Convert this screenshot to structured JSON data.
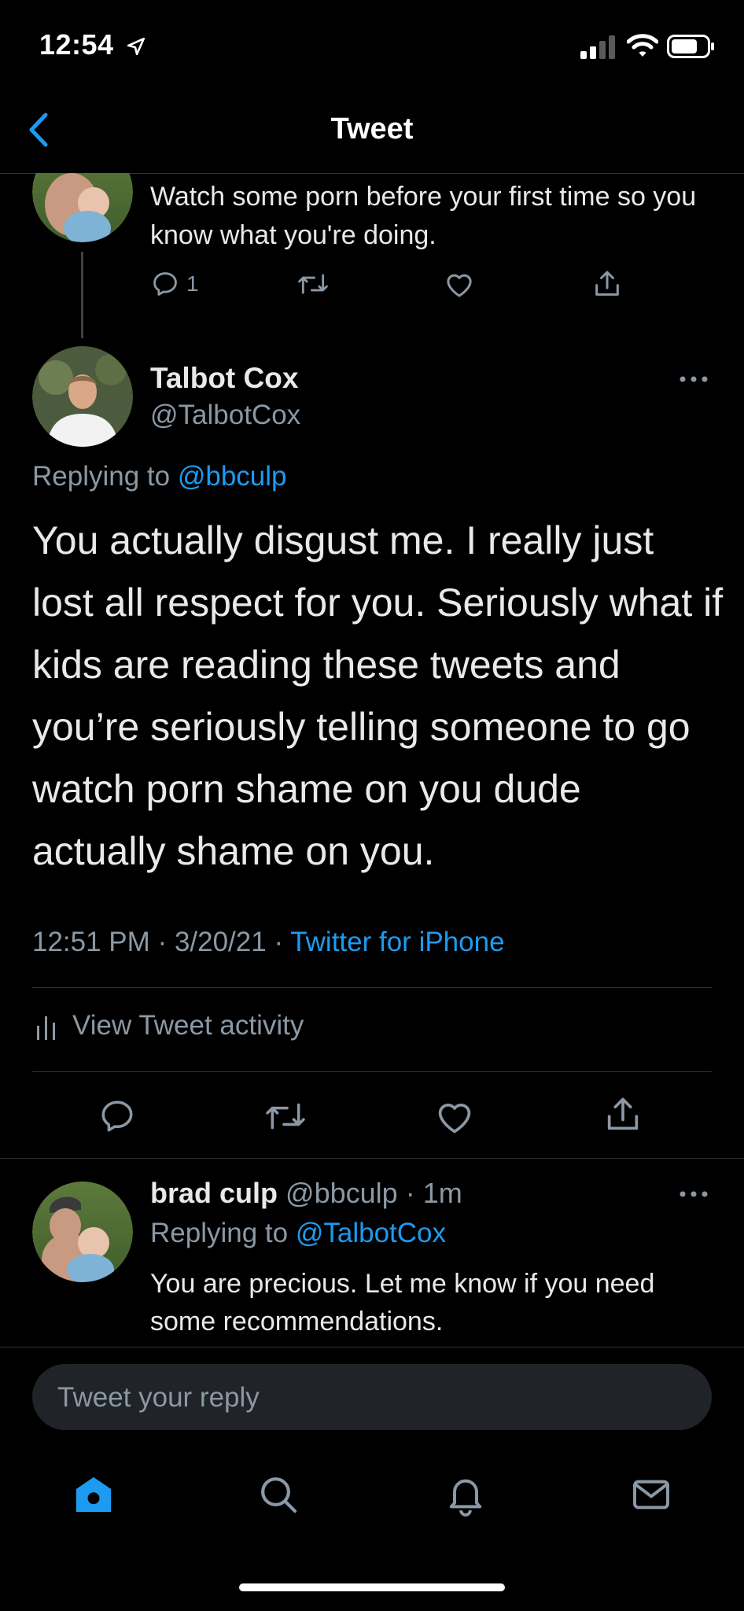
{
  "status_bar": {
    "time": "12:54"
  },
  "nav": {
    "title": "Tweet"
  },
  "parent_tweet": {
    "text": "Watch some porn before your first time so you know what you're doing.",
    "reply_count": "1"
  },
  "main_tweet": {
    "name": "Talbot Cox",
    "handle": "@TalbotCox",
    "replying_prefix": "Replying to",
    "replying_to": "@bbculp",
    "text": "You actually disgust me. I really just lost all respect for you. Seriously what if kids are reading these tweets and you’re seriously telling someone to go watch porn shame on you dude actually shame on you.",
    "time": "12:51 PM",
    "date": "3/20/21",
    "source": "Twitter for iPhone",
    "activity_label": "View Tweet activity"
  },
  "reply": {
    "name": "brad culp",
    "handle": "@bbculp",
    "age": "1m",
    "replying_prefix": "Replying to",
    "replying_to": "@TalbotCox",
    "text": "You are precious. Let me know if you need some recommendations."
  },
  "composer": {
    "placeholder": "Tweet your reply"
  },
  "colors": {
    "accent": "#1d9bf0",
    "muted": "#8b98a5",
    "background": "#000000"
  },
  "icons": [
    "back-chevron-icon",
    "reply-icon",
    "retweet-icon",
    "like-icon",
    "share-icon",
    "more-icon",
    "activity-icon",
    "home-icon",
    "search-icon",
    "notifications-icon",
    "messages-icon"
  ]
}
